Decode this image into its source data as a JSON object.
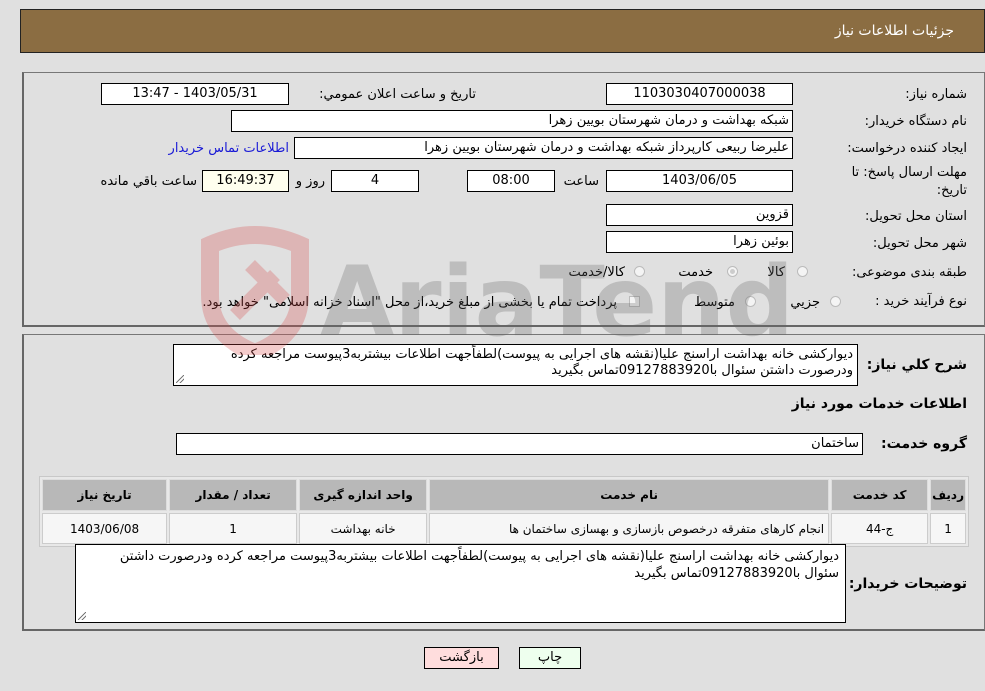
{
  "header": {
    "title": "جزئیات اطلاعات نیاز"
  },
  "details": {
    "need_number_label": "شماره نیاز:",
    "need_number": "1103030407000038",
    "announce_label": "تاریخ و ساعت اعلان عمومي:",
    "announce_value": "1403/05/31 - 13:47",
    "buyer_org_label": "نام دستگاه خریدار:",
    "buyer_org": "شبکه بهداشت و درمان شهرستان بویین زهرا",
    "creator_label": "ایجاد کننده درخواست:",
    "creator": "علیرضا ربیعی کارپرداز شبکه بهداشت و درمان شهرستان بویین زهرا",
    "contact_link": "اطلاعات تماس خریدار",
    "deadline_label": "مهلت ارسال پاسخ: تا تاریخ:",
    "deadline_date": "1403/06/05",
    "time_label": "ساعت",
    "deadline_time": "08:00",
    "days_value": "4",
    "days_label": "روز و",
    "remaining_time": "16:49:37",
    "remaining_label": "ساعت باقي مانده",
    "province_label": "استان محل تحویل:",
    "province": "قزوین",
    "city_label": "شهر محل تحویل:",
    "city": "بوئین زهرا",
    "category_label": "طبقه بندی موضوعی:",
    "category_options": [
      {
        "label": "کالا",
        "selected": false
      },
      {
        "label": "خدمت",
        "selected": true
      },
      {
        "label": "کالا/خدمت",
        "selected": false
      }
    ],
    "process_label": "نوع فرآیند خرید :",
    "process_options": [
      {
        "label": "جزيي",
        "selected": false
      },
      {
        "label": "متوسط",
        "selected": false
      }
    ],
    "treasury_note": "پرداخت تمام یا بخشی از مبلغ خرید،از محل \"اسناد خزانه اسلامی\" خواهد بود."
  },
  "services": {
    "description_label": "شرح کلي نیاز:",
    "description": "دیوارکشی خانه بهداشت اراسنج علیا(نقشه های اجرایی به پیوست)لطفاًجهت اطلاعات بیشتربه3پیوست مراجعه کرده ودرصورت داشتن سئوال با09127883920تماس بگیرید",
    "section_title": "اطلاعات خدمات مورد نیاز",
    "group_label": "گروه خدمت:",
    "group_value": "ساختمان",
    "table": {
      "headers": [
        "ردیف",
        "کد خدمت",
        "نام خدمت",
        "واحد اندازه گیری",
        "تعداد / مقدار",
        "تاریخ نیاز"
      ],
      "rows": [
        [
          "1",
          "ج-44",
          "انجام کارهای متفرقه درخصوص بازسازی و بهسازی ساختمان ها",
          "خانه بهداشت",
          "1",
          "1403/06/08"
        ]
      ]
    },
    "buyer_notes_label": "توضیحات خریدار:",
    "buyer_notes": "دیوارکشی خانه بهداشت اراسنج علیا(نقشه های اجرایی به پیوست)لطفاًجهت اطلاعات بیشتربه3پیوست مراجعه کرده ودرصورت داشتن سئوال با09127883920تماس بگیرید"
  },
  "buttons": {
    "print": "چاپ",
    "back": "بازگشت"
  },
  "watermark": {
    "text": "AriaTender.neT"
  }
}
